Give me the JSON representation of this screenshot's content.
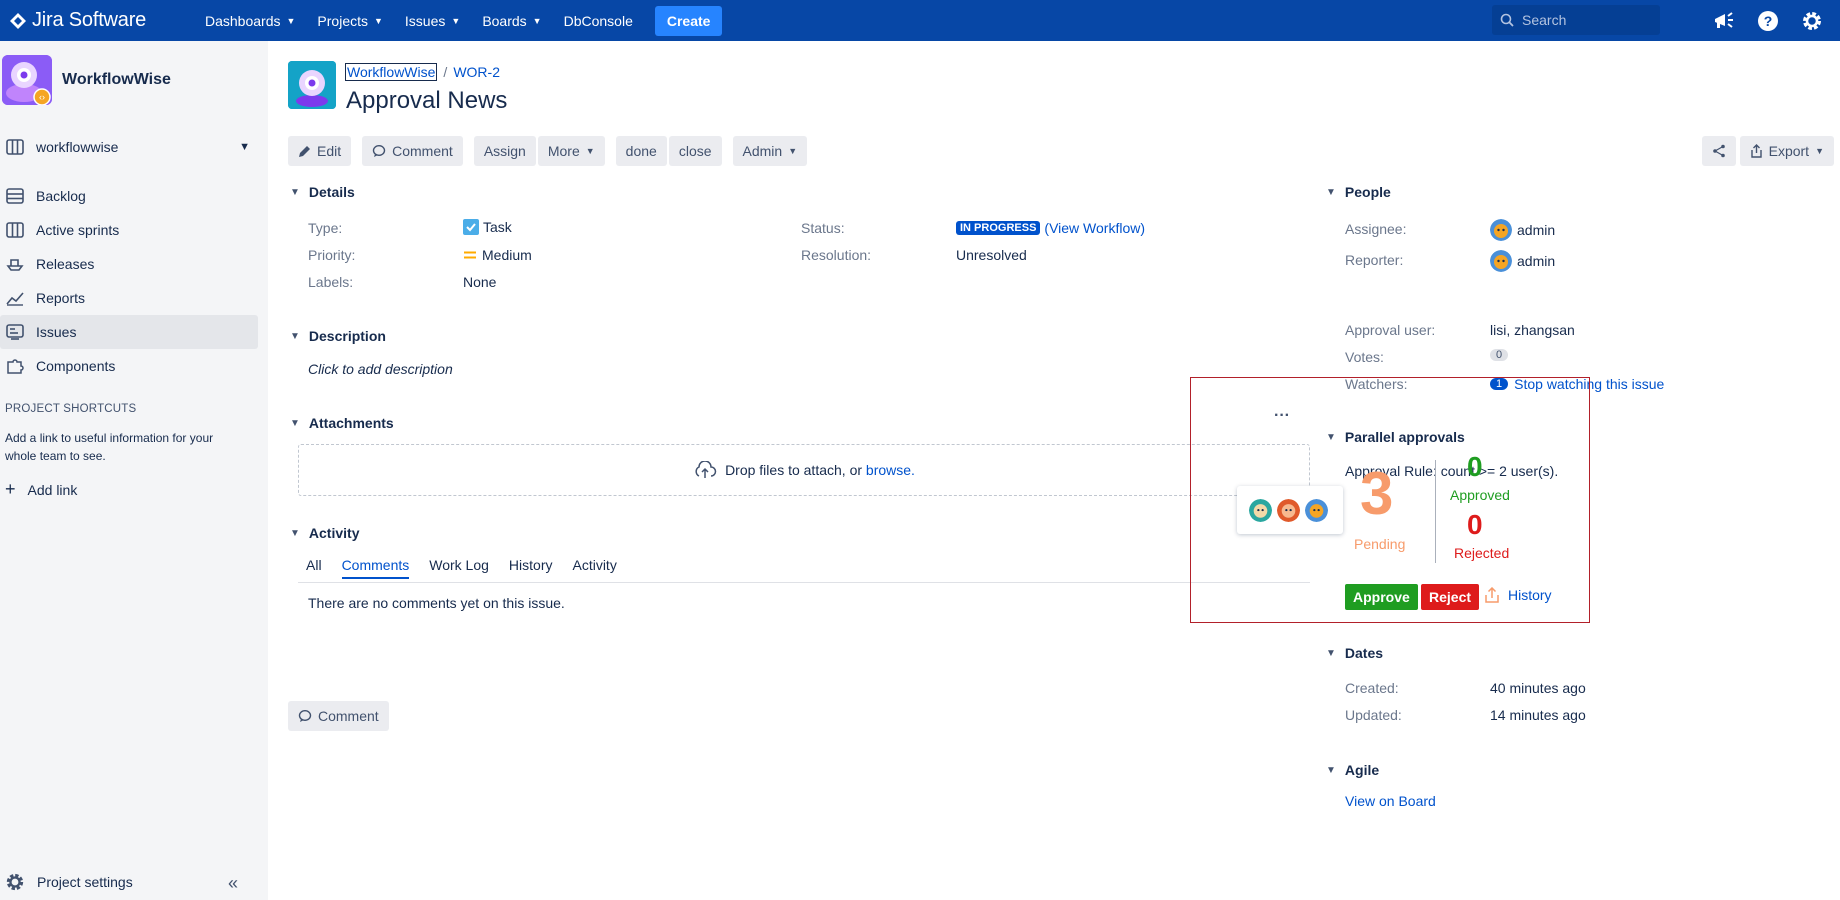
{
  "topnav": {
    "logo": "Jira Software",
    "items": [
      "Dashboards",
      "Projects",
      "Issues",
      "Boards",
      "DbConsole"
    ],
    "create": "Create",
    "search_placeholder": "Search"
  },
  "sidebar": {
    "project_name": "WorkflowWise",
    "board": "workflowwise",
    "items": [
      "Backlog",
      "Active sprints",
      "Releases",
      "Reports",
      "Issues",
      "Components"
    ],
    "active_index": 4,
    "shortcuts_title": "PROJECT SHORTCUTS",
    "shortcuts_text": "Add a link to useful information for your whole team to see.",
    "add_link": "Add link",
    "project_settings": "Project settings"
  },
  "issue": {
    "project": "WorkflowWise",
    "key": "WOR-2",
    "title": "Approval News"
  },
  "toolbar": {
    "edit": "Edit",
    "comment": "Comment",
    "assign": "Assign",
    "more": "More",
    "done": "done",
    "close": "close",
    "admin": "Admin",
    "export": "Export"
  },
  "details": {
    "heading": "Details",
    "type_label": "Type:",
    "type_value": "Task",
    "priority_label": "Priority:",
    "priority_value": "Medium",
    "labels_label": "Labels:",
    "labels_value": "None",
    "status_label": "Status:",
    "status_value": "IN PROGRESS",
    "view_workflow": "(View Workflow)",
    "resolution_label": "Resolution:",
    "resolution_value": "Unresolved"
  },
  "description": {
    "heading": "Description",
    "placeholder": "Click to add description"
  },
  "attachments": {
    "heading": "Attachments",
    "drop_text": "Drop files to attach, or",
    "browse": "browse."
  },
  "activity": {
    "heading": "Activity",
    "tabs": [
      "All",
      "Comments",
      "Work Log",
      "History",
      "Activity"
    ],
    "active_tab": 1,
    "empty": "There are no comments yet on this issue.",
    "comment_button": "Comment"
  },
  "people": {
    "heading": "People",
    "assignee_label": "Assignee:",
    "assignee": "admin",
    "reporter_label": "Reporter:",
    "reporter": "admin",
    "approval_user_label": "Approval user:",
    "approval_users": "lisi, zhangsan",
    "votes_label": "Votes:",
    "votes": "0",
    "watchers_label": "Watchers:",
    "watchers": "1",
    "stop_watching": "Stop watching this issue"
  },
  "approvals": {
    "heading": "Parallel approvals",
    "rule": "Approval Rule: count >= 2 user(s).",
    "pending": "3",
    "pending_label": "Pending",
    "approved": "0",
    "approved_label": "Approved",
    "rejected": "0",
    "rejected_label": "Rejected",
    "approve": "Approve",
    "reject": "Reject",
    "history": "History"
  },
  "dates": {
    "heading": "Dates",
    "created_label": "Created:",
    "created": "40 minutes ago",
    "updated_label": "Updated:",
    "updated": "14 minutes ago"
  },
  "agile": {
    "heading": "Agile",
    "link": "View on Board"
  },
  "colors": {
    "nav": "#0747a6",
    "accent": "#0052cc",
    "pending": "#f79b6b",
    "approved": "#1f9d21",
    "rejected": "#de1b1b"
  }
}
